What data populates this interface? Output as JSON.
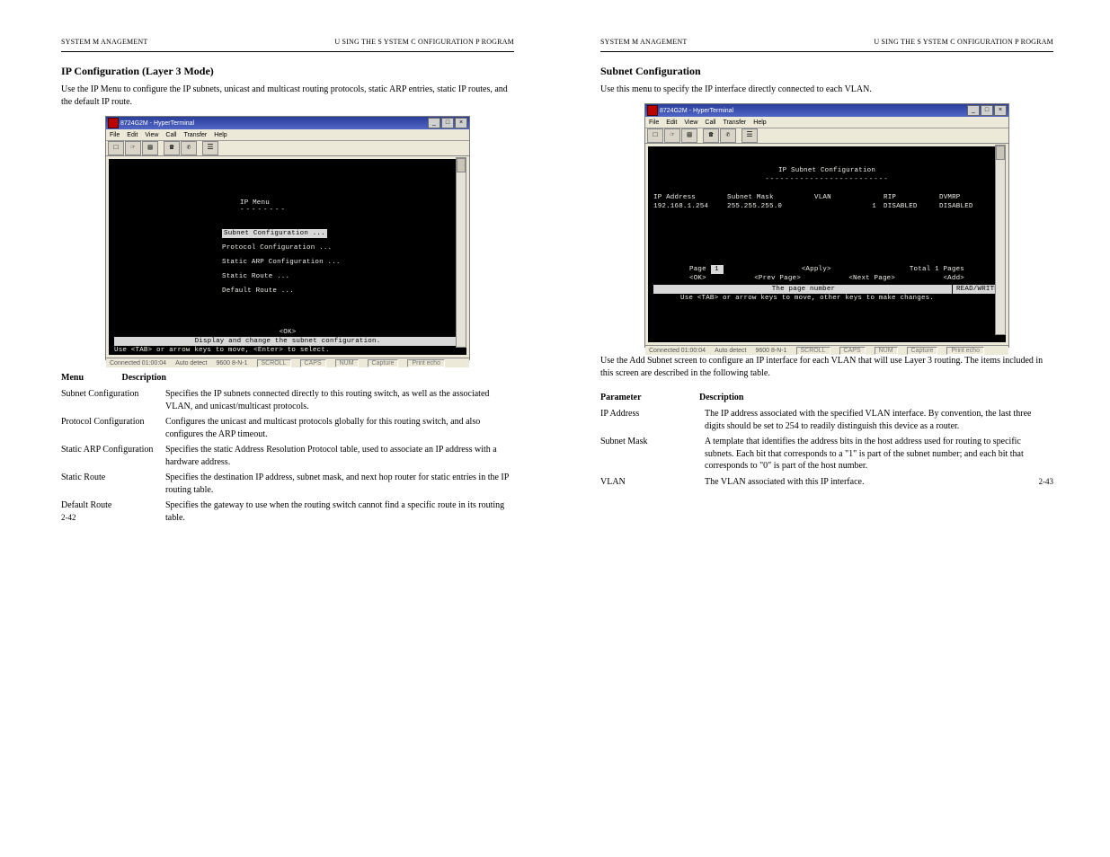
{
  "left": {
    "header": {
      "left": "SYSTEM M ANAGEMENT",
      "right": "U SING THE  S YSTEM  C ONFIGURATION  P ROGRAM"
    },
    "title": "IP Configuration (Layer 3 Mode)",
    "intro": "Use the IP Menu to configure the IP subnets, unicast and multicast routing protocols, static ARP entries, static IP routes, and the default IP route.",
    "menuItems": [
      {
        "k": "Subnet Configuration",
        "v": "Specifies the IP subnets connected directly to this routing switch, as well as the associated VLAN, and unicast/multicast protocols."
      },
      {
        "k": "Protocol Configuration",
        "v": "Configures the unicast and multicast protocols globally for this routing switch, and also configures the ARP timeout."
      },
      {
        "k": "Static ARP Configuration",
        "v": "Specifies the static Address Resolution Protocol table, used to associate an IP address with a hardware address."
      },
      {
        "k": "Static Route",
        "v": "Specifies the destination IP address, subnet mask, and next hop router for static entries in the IP routing table."
      },
      {
        "k": "Default Route",
        "v": "Specifies the gateway to use when the routing switch cannot find a specific route in its routing table."
      }
    ],
    "pageNum": "2-42"
  },
  "right": {
    "header": {
      "left": "SYSTEM M ANAGEMENT",
      "right": "U SING THE  S YSTEM  C ONFIGURATION  P ROGRAM"
    },
    "title": "Subnet Configuration",
    "intro": "Use this menu to specify the IP interface directly connected to each VLAN.",
    "descIntro": "Use the Add Subnet screen to configure an IP interface for each VLAN that will use Layer 3 routing. The items included in this screen are described in the following table.",
    "descTitle": "Description",
    "descRows": [
      {
        "k": "IP Address",
        "v": "The IP address associated with the specified VLAN interface. By convention, the last three digits should be set to 254 to readily distinguish this device as a router."
      },
      {
        "k": "Subnet Mask",
        "v": "A template that identifies the address bits in the host address used for routing to specific subnets. Each bit that corresponds to a \"1\" is part of the subnet number; and each bit that corresponds to \"0\" is part of the host number."
      },
      {
        "k": "VLAN",
        "v": "The VLAN associated with this IP interface."
      }
    ],
    "pageNum": "2-43"
  },
  "ht": {
    "winTitle": "8724G2M - HyperTerminal",
    "menus": [
      "File",
      "Edit",
      "View",
      "Call",
      "Transfer",
      "Help"
    ],
    "status": {
      "conn": "Connected 01:00:04",
      "mode": "Auto detect",
      "proto": "9600 8-N-1",
      "scroll": "SCROLL",
      "caps": "CAPS",
      "num": "NUM",
      "capture": "Capture",
      "print": "Print echo"
    },
    "wbtns": {
      "min": "_",
      "max": "□",
      "close": "×"
    }
  },
  "term1": {
    "title": "IP Menu",
    "under": "--------",
    "items": [
      "Subnet Configuration ...",
      "Protocol Configuration ...",
      "Static ARP Configuration ...",
      "Static Route ...",
      "Default Route ..."
    ],
    "ok": "<OK>",
    "hint1": "Display and change the subnet configuration.",
    "hint2": "Use <TAB> or arrow keys to move, <Enter> to select."
  },
  "term2": {
    "title": "IP Subnet Configuration",
    "under": "-------------------------",
    "headers": [
      "IP Address",
      "Subnet Mask",
      "VLAN",
      "RIP",
      "DVMRP"
    ],
    "row": [
      "192.168.1.254",
      "255.255.255.0",
      "1",
      "DISABLED",
      "DISABLED"
    ],
    "pageLabel": "Page",
    "pageVal": "1",
    "apply": "<Apply>",
    "total": "Total  1 Pages",
    "ok": "<OK>",
    "prev": "<Prev Page>",
    "next": "<Next Page>",
    "add": "<Add>",
    "barlabel": "The page number",
    "rw": "READ/WRITE",
    "hint": "Use <TAB> or arrow keys to move, other keys to make changes."
  }
}
